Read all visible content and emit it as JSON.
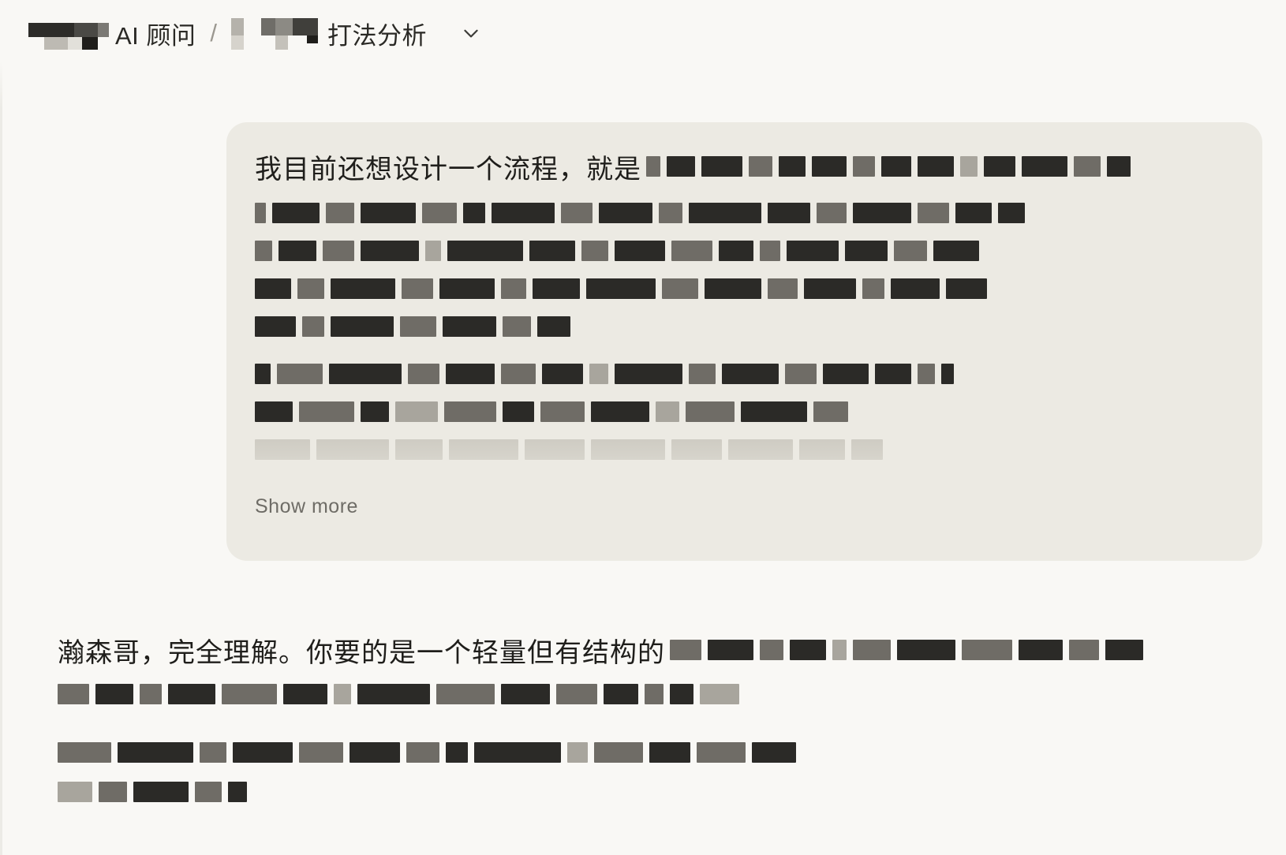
{
  "header": {
    "breadcrumb_part1": "AI 顾问",
    "separator": "/",
    "breadcrumb_part2": "打法分析",
    "dropdown_icon": "chevron-down-icon"
  },
  "user_message": {
    "visible_text": "我目前还想设计一个流程，就是",
    "show_more_label": "Show more"
  },
  "assistant_message": {
    "visible_text": "瀚森哥，完全理解。你要的是一个轻量但有结构的"
  },
  "colors": {
    "background": "#f9f8f5",
    "user_bubble": "#eceae3",
    "text": "#1f1e1b",
    "muted_text": "#6e6c66"
  }
}
